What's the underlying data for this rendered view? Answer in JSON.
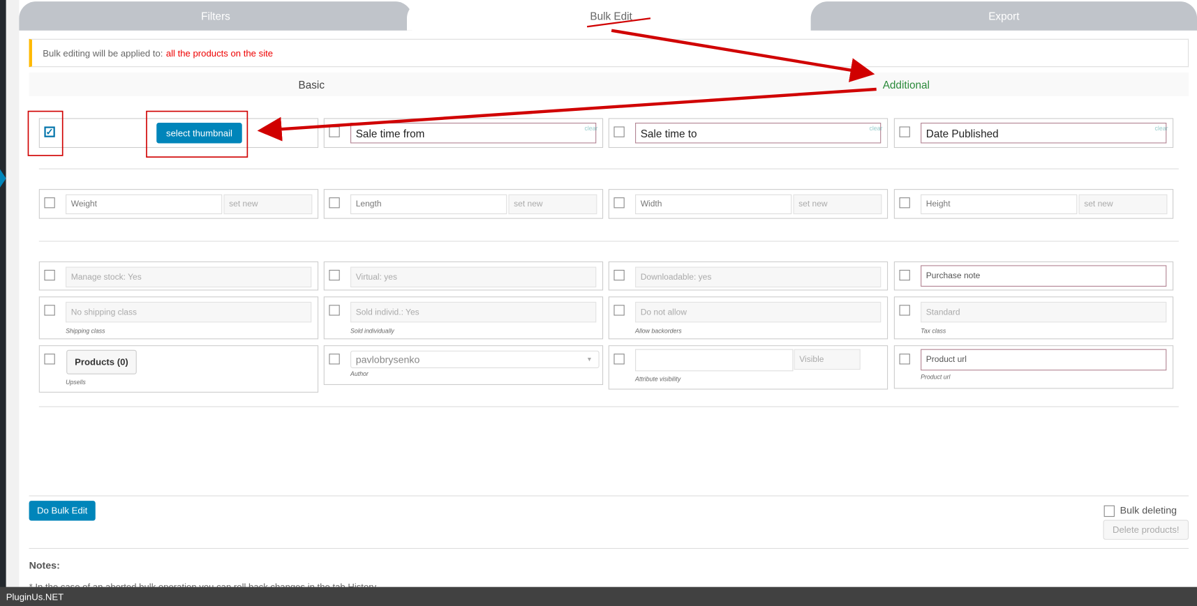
{
  "tabs": [
    {
      "label": "Filters",
      "active": false
    },
    {
      "label": "Bulk Edit",
      "active": true
    },
    {
      "label": "Export",
      "active": false
    }
  ],
  "notice": {
    "prefix": "Bulk editing will be applied to:",
    "target": "all the products on the site"
  },
  "subtabs": [
    {
      "label": "Basic"
    },
    {
      "label": "Additional"
    }
  ],
  "rows": [
    [
      {
        "type": "thumb",
        "checked": true,
        "button": "select thumbnail"
      },
      {
        "type": "date",
        "value": "Sale time from",
        "clear": "clear"
      },
      {
        "type": "date",
        "value": "Sale time to",
        "clear": "clear"
      },
      {
        "type": "date",
        "value": "Date Published",
        "clear": "clear"
      }
    ],
    [
      {
        "type": "num",
        "placeholder": "Weight",
        "select": "set new"
      },
      {
        "type": "num",
        "placeholder": "Length",
        "select": "set new"
      },
      {
        "type": "num",
        "placeholder": "Width",
        "select": "set new"
      },
      {
        "type": "num",
        "placeholder": "Height",
        "select": "set new"
      }
    ],
    [
      {
        "type": "dis",
        "value": "Manage stock: Yes"
      },
      {
        "type": "dis",
        "value": "Virtual: yes"
      },
      {
        "type": "dis",
        "value": "Downloadable: yes"
      },
      {
        "type": "text",
        "placeholder": "Purchase note"
      }
    ],
    [
      {
        "type": "dis",
        "value": "No shipping class",
        "caption": "Shipping class"
      },
      {
        "type": "dis",
        "value": "Sold individ.: Yes",
        "caption": "Sold individually"
      },
      {
        "type": "dis",
        "value": "Do not allow",
        "caption": "Allow backorders"
      },
      {
        "type": "dis",
        "value": "Standard",
        "caption": "Tax class"
      }
    ],
    [
      {
        "type": "button",
        "button": "Products (0)",
        "caption": "Upsells"
      },
      {
        "type": "select",
        "value": "pavlobrysenko",
        "caption": "Author"
      },
      {
        "type": "attr",
        "value": "",
        "select": "Visible",
        "caption": "Attribute visibility"
      },
      {
        "type": "text",
        "placeholder": "Product url",
        "caption": "Product url"
      }
    ]
  ],
  "actions": {
    "do_bulk_edit": "Do Bulk Edit",
    "bulk_deleting": "Bulk deleting",
    "delete_products": "Delete products!"
  },
  "notes": {
    "title": "Notes:",
    "line1": "* In the case of an aborted bulk operation you can roll back changes in the tab History"
  },
  "footer": {
    "brand": "PluginUs.NET"
  },
  "colors": {
    "accent": "#0085ba",
    "annotation": "#d00000",
    "notice_border": "#ffb900",
    "additional": "#2a8a3a"
  }
}
